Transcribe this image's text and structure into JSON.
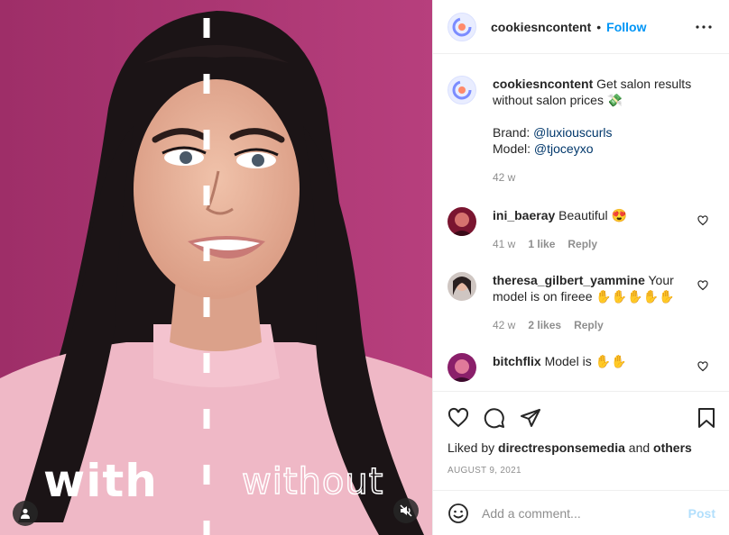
{
  "media": {
    "overlay_left": "with",
    "overlay_right": "without",
    "tag_icon": "person-tag-icon",
    "mute_icon": "speaker-muted-icon"
  },
  "header": {
    "username": "cookiesncontent",
    "separator": "•",
    "follow_label": "Follow",
    "more_icon": "ellipsis-icon"
  },
  "caption": {
    "username": "cookiesncontent",
    "text": "Get salon results without salon prices 💸",
    "brand_label": "Brand: ",
    "brand_handle": "@luxiouscurls",
    "model_label": "Model: ",
    "model_handle": "@tjoceyxo",
    "age": "42 w"
  },
  "comments": [
    {
      "username": "ini_baeray",
      "text": "Beautiful 😍",
      "age": "41 w",
      "likes": "1 like",
      "reply": "Reply"
    },
    {
      "username": "theresa_gilbert_yammine",
      "text": "Your model is on fireee ✋✋✋✋✋",
      "age": "42 w",
      "likes": "2 likes",
      "reply": "Reply"
    },
    {
      "username": "bitchflix",
      "text": "Model is ✋✋"
    }
  ],
  "actions": {
    "like_icon": "heart-icon",
    "comment_icon": "comment-bubble-icon",
    "share_icon": "paper-plane-icon",
    "save_icon": "bookmark-icon",
    "liked_by_prefix": "Liked by ",
    "liked_by_user": "directresponsemedia",
    "liked_by_and": " and ",
    "liked_by_others": "others",
    "date": "AUGUST 9, 2021"
  },
  "add_comment": {
    "placeholder": "Add a comment...",
    "post_label": "Post",
    "emoji_icon": "smiley-icon"
  },
  "colors": {
    "accent": "#0095f6",
    "post_disabled": "#b2dffc",
    "background_magenta": "#b03a78",
    "muted_text": "#8e8e8e"
  }
}
